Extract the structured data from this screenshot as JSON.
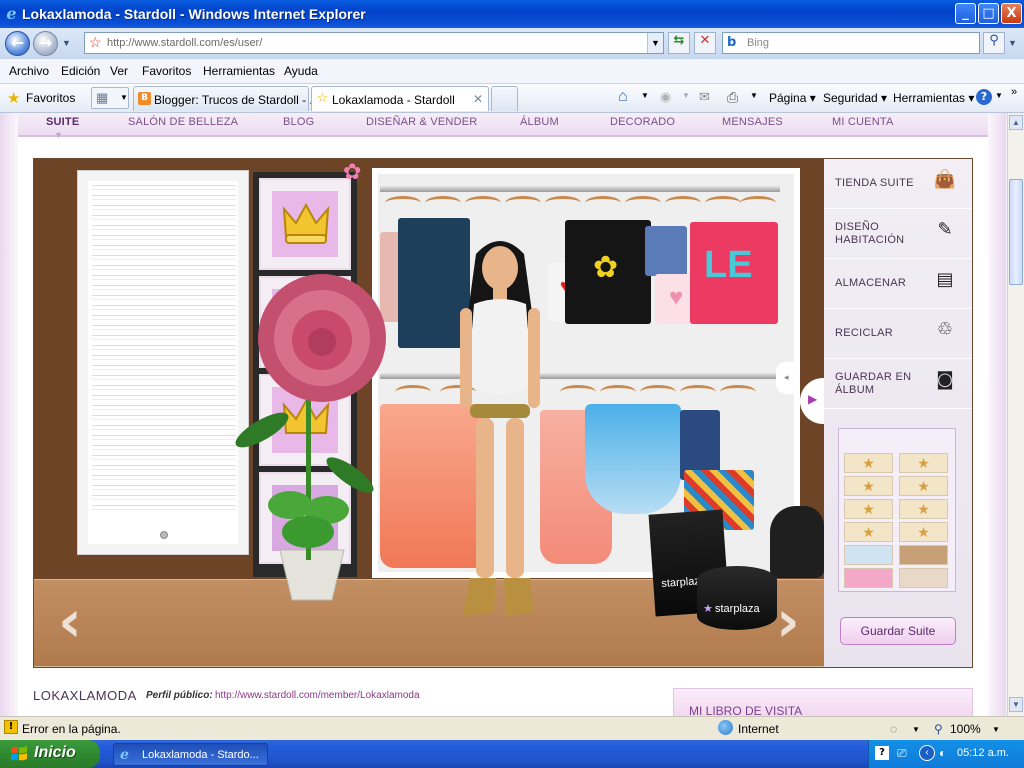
{
  "window": {
    "title": "Lokaxlamoda - Stardoll - Windows Internet Explorer",
    "buttons": [
      "_",
      "□",
      "X"
    ]
  },
  "address": {
    "url": "http://www.stardoll.com/es/user/",
    "search_placeholder": "Bing"
  },
  "menu": [
    "Archivo",
    "Edición",
    "Ver",
    "Favoritos",
    "Herramientas",
    "Ayuda"
  ],
  "favorites_label": "Favoritos",
  "tabs": [
    {
      "label": "Blogger: Trucos de Stardoll - ...",
      "active": false
    },
    {
      "label": "Lokaxlamoda - Stardoll",
      "active": true
    }
  ],
  "command_bar": [
    "Página",
    "Seguridad",
    "Herramientas"
  ],
  "site_nav": [
    "SUITE",
    "SALÓN DE BELLEZA",
    "BLOG",
    "DISEÑAR & VENDER",
    "ÁLBUM",
    "DECORADO",
    "MENSAJES",
    "MI CUENTA"
  ],
  "right_panel": [
    {
      "label": "TIENDA SUITE",
      "icon": "shopping-bag-icon"
    },
    {
      "label": "DISEÑO HABITACIÓN",
      "icon": "brush-icon"
    },
    {
      "label": "ALMACENAR",
      "icon": "drawer-icon"
    },
    {
      "label": "RECICLAR",
      "icon": "trash-icon"
    },
    {
      "label": "GUARDAR EN ÁLBUM",
      "icon": "camera-icon"
    }
  ],
  "save_button": "Guardar Suite",
  "bag_brand": "starplaza",
  "profile": {
    "name": "LOKAXLAMODA",
    "public_label": "Perfil público:",
    "public_url": "http://www.stardoll.com/member/Lokaxlamoda"
  },
  "guestbook_title": "MI LIBRO DE VISITA",
  "status": {
    "message": "Error en la página.",
    "zone": "Internet",
    "zoom": "100%"
  },
  "taskbar": {
    "start_label": "Inicio",
    "window_button": "Lokaxlamoda - Stardo...",
    "clock": "05:12 a.m."
  },
  "colors": {
    "accent": "#7a4f8a",
    "titlebar": "#0a5de0",
    "taskbar": "#245edb",
    "start": "#2f8a2f"
  }
}
